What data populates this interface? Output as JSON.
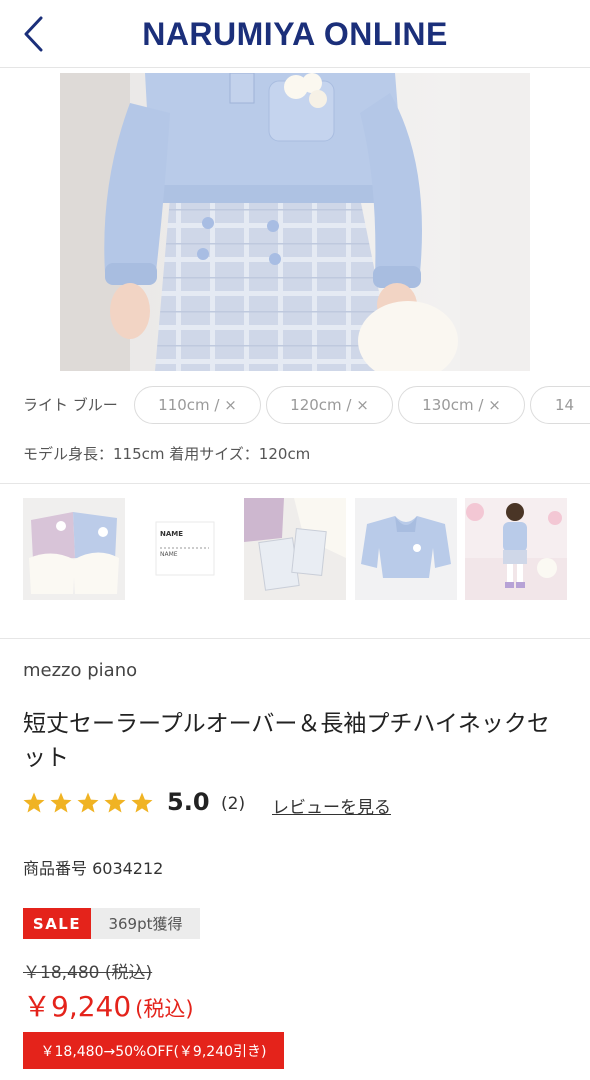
{
  "header": {
    "logo": "NARUMIYA ONLINE"
  },
  "variant": {
    "color_label": "ライト ブルー",
    "sizes": [
      "110cm / ×",
      "120cm / ×",
      "130cm / ×",
      "14"
    ]
  },
  "model_info": "モデル身長：115cm 着用サイズ：120cm",
  "thumbs": [
    {
      "label": ""
    },
    {
      "label": "NAME"
    },
    {
      "label": ""
    },
    {
      "label": ""
    },
    {
      "label": ""
    }
  ],
  "product": {
    "brand": "mezzo piano",
    "title": "短丈セーラープルオーバー＆長袖プチハイネックセット",
    "rating": 5.0,
    "rating_display": "5.0",
    "review_count": "(2)",
    "review_link": "レビューを見る",
    "item_number": "商品番号 6034212"
  },
  "pricing": {
    "sale_badge": "SALE",
    "points": "369pt獲得",
    "original": "￥18,480 (税込)",
    "sale_amount": "￥9,240",
    "sale_tax": "(税込)",
    "discount_text": "￥18,480→50%OFF(￥9,240引き)"
  },
  "colors": {
    "brand_navy": "#1b2f7a",
    "sale_red": "#e4231b",
    "star_gold": "#f0b323",
    "garment_blue": "#b9cbe9"
  },
  "icons": [
    "chevron-left-icon",
    "star-icon"
  ]
}
